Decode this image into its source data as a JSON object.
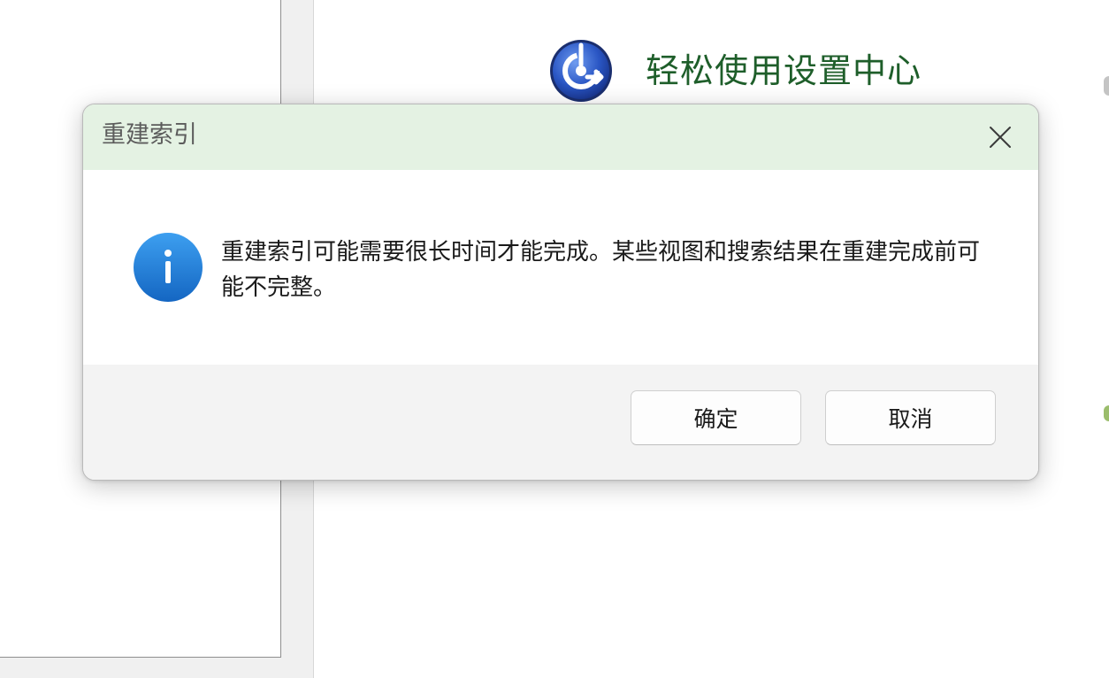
{
  "background": {
    "control_panel_title": "轻松使用设置中心",
    "control_panel_icon": "ease-of-access-icon"
  },
  "dialog": {
    "title": "重建索引",
    "close_icon": "close-icon",
    "info_icon": "info-icon",
    "message": "重建索引可能需要很长时间才能完成。某些视图和搜索结果在重建完成前可能不完整。",
    "ok_label": "确定",
    "cancel_label": "取消"
  },
  "colors": {
    "titlebar": "#e4f2e3",
    "info_blue": "#1f7fd6",
    "title_green": "#1e5e2a"
  }
}
